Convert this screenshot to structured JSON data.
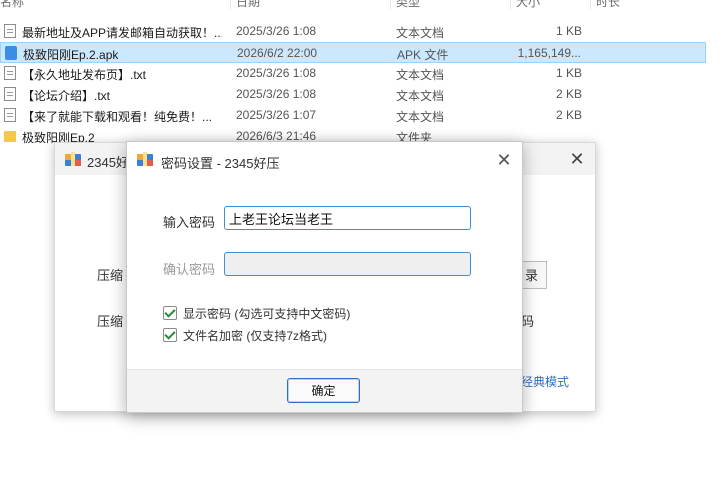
{
  "explorer": {
    "columns": {
      "name": "名称",
      "date": "日期",
      "type": "类型",
      "size": "大小",
      "duration": "时长"
    },
    "files": [
      {
        "name": "最新地址及APP请发邮箱自动获取！...",
        "date": "2025/3/26 1:08",
        "type": "文本文档",
        "size": "1 KB",
        "icon": "text-file-icon"
      },
      {
        "name": "极致阳刚Ep.2.apk",
        "date": "2026/6/2 22:00",
        "type": "APK 文件",
        "size": "1,165,149...",
        "icon": "apk-file-icon",
        "selected": true
      },
      {
        "name": "【永久地址发布页】.txt",
        "date": "2025/3/26 1:08",
        "type": "文本文档",
        "size": "1 KB",
        "icon": "text-file-icon"
      },
      {
        "name": "【论坛介绍】.txt",
        "date": "2025/3/26 1:08",
        "type": "文本文档",
        "size": "2 KB",
        "icon": "text-file-icon"
      },
      {
        "name": "【来了就能下载和观看！纯免费！...",
        "date": "2025/3/26 1:07",
        "type": "文本文档",
        "size": "2 KB",
        "icon": "text-file-icon"
      },
      {
        "name": "极致阳刚Ep.2",
        "date": "2026/6/3 21:46",
        "type": "文件夹",
        "size": "",
        "icon": "folder-icon"
      }
    ]
  },
  "back_dialog": {
    "title": "2345好",
    "label1": "压缩",
    "label2": "压缩",
    "button": "录",
    "label3": "码",
    "link": "经典模式"
  },
  "password_dialog": {
    "title": "密码设置 - 2345好压",
    "input_label": "输入密码",
    "password_value": "上老王论坛当老王",
    "confirm_label": "确认密码",
    "show_password_label": "显示密码 (勾选可支持中文密码)",
    "show_password_checked": true,
    "encrypt_names_label": "文件名加密 (仅支持7z格式)",
    "encrypt_names_checked": true,
    "ok_button": "确定"
  },
  "colors": {
    "selection": "#cce8ff",
    "accent": "#3f8fd8",
    "link": "#2f6fc0",
    "folder": "#f4c64e"
  }
}
